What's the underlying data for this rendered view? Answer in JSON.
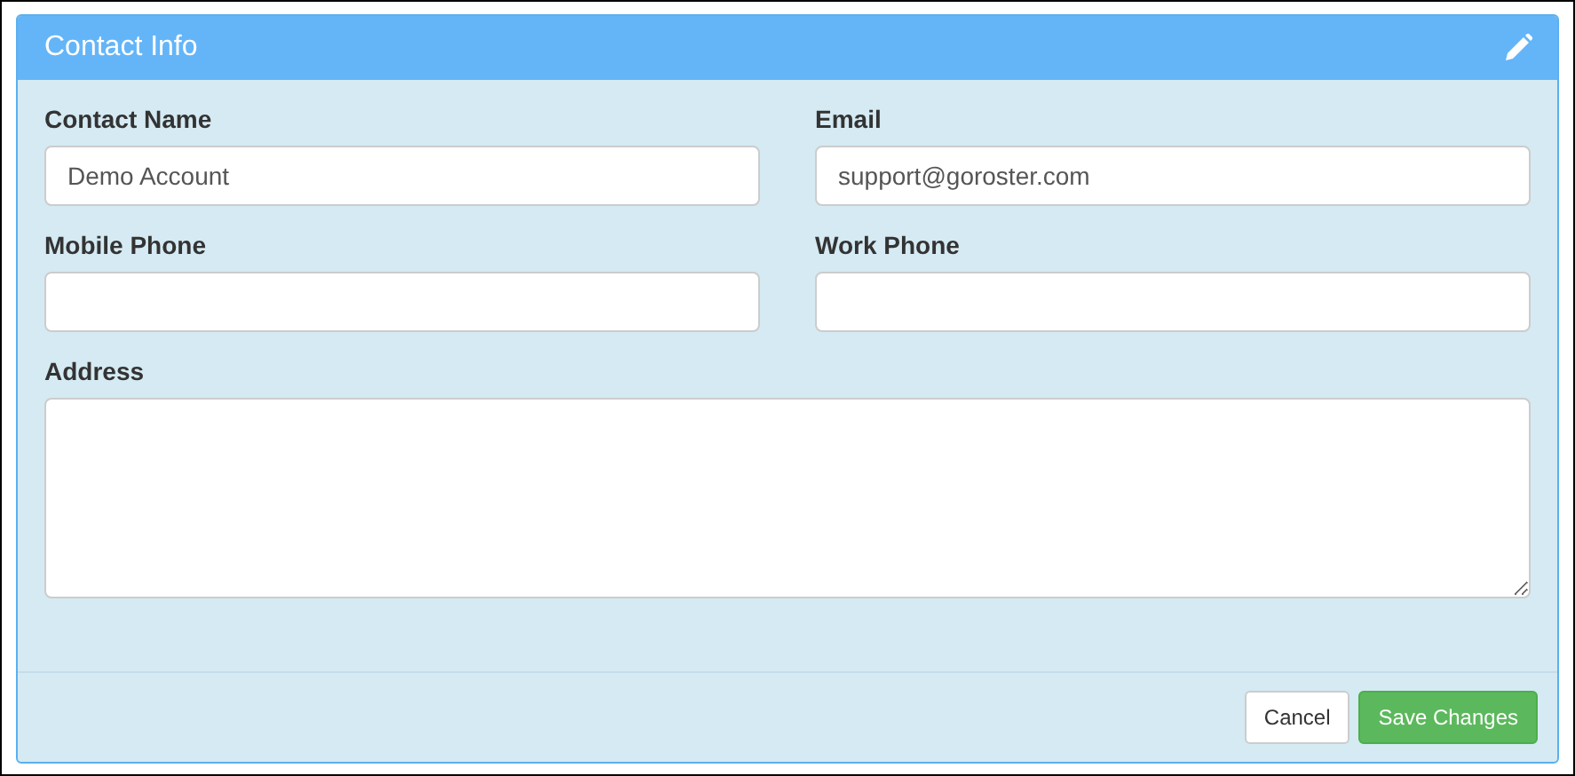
{
  "panel": {
    "title": "Contact Info"
  },
  "fields": [
    {
      "label": "Contact Name",
      "value": "Demo Account",
      "kind": "input"
    },
    {
      "label": "Email",
      "value": "support@goroster.com",
      "kind": "input"
    },
    {
      "label": "Mobile Phone",
      "kind": "input"
    },
    {
      "label": "Work Phone",
      "kind": "input"
    },
    {
      "label": "Address",
      "kind": "textarea"
    }
  ],
  "buttons": [
    {
      "label": "Cancel",
      "kind": "default"
    },
    {
      "label": "Save Changes",
      "kind": "primary"
    }
  ]
}
